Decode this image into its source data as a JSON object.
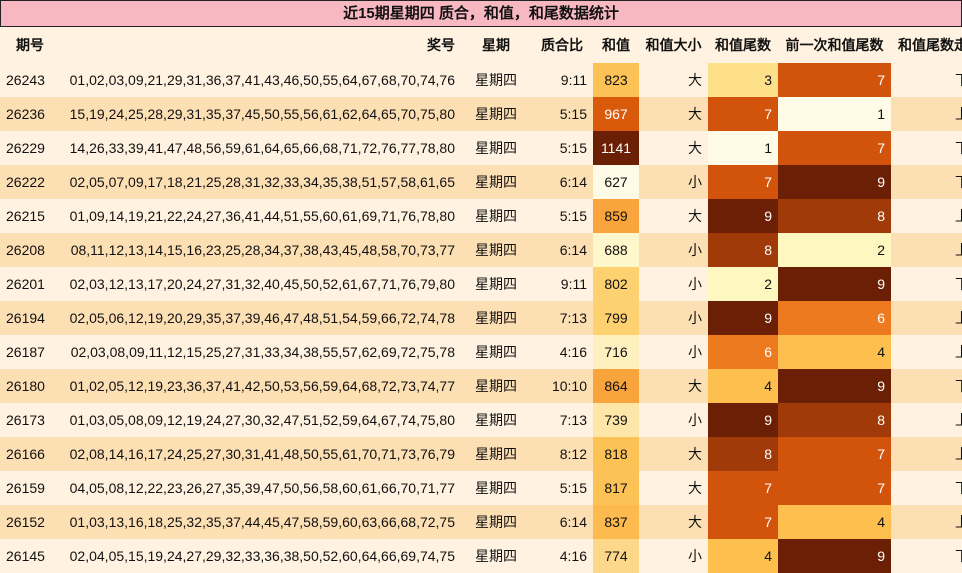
{
  "title": "近15期星期四 质合，和值，和尾数据统计",
  "headers": {
    "issue": "期号",
    "numbers": "奖号",
    "weekday": "星期",
    "ratio": "质合比",
    "sum": "和值",
    "size": "和值大小",
    "tail": "和值尾数",
    "prev_tail": "前一次和值尾数",
    "trend": "和值尾数走势"
  },
  "heat_colors": {
    "sum": {
      "627": "#fffbe6",
      "688": "#fff7cc",
      "716": "#fff0c0",
      "739": "#fde6a8",
      "774": "#fdd88a",
      "799": "#fdd070",
      "802": "#fdd070",
      "817": "#fdc256",
      "818": "#fdc256",
      "823": "#fdc256",
      "837": "#fdba4e",
      "859": "#f9a43c",
      "864": "#f9a43c",
      "967": "#d85a0a",
      "1141": "#6b2005"
    },
    "tail": {
      "1": "#fffbe6",
      "2": "#fff7c0",
      "3": "#fee08b",
      "4": "#fdc04e",
      "6": "#ee7a20",
      "7": "#d2540c",
      "8": "#a03a08",
      "9": "#6b2005"
    }
  },
  "rows": [
    {
      "issue": "26243",
      "numbers": "01,02,03,09,21,29,31,36,37,41,43,46,50,55,64,67,68,70,74,76",
      "weekday": "星期四",
      "ratio": "9:11",
      "sum": "823",
      "size": "大",
      "tail": "3",
      "prev_tail": "7",
      "trend": "下降"
    },
    {
      "issue": "26236",
      "numbers": "15,19,24,25,28,29,31,35,37,45,50,55,56,61,62,64,65,70,75,80",
      "weekday": "星期四",
      "ratio": "5:15",
      "sum": "967",
      "size": "大",
      "tail": "7",
      "prev_tail": "1",
      "trend": "上升"
    },
    {
      "issue": "26229",
      "numbers": "14,26,33,39,41,47,48,56,59,61,64,65,66,68,71,72,76,77,78,80",
      "weekday": "星期四",
      "ratio": "5:15",
      "sum": "1141",
      "size": "大",
      "tail": "1",
      "prev_tail": "7",
      "trend": "下降"
    },
    {
      "issue": "26222",
      "numbers": "02,05,07,09,17,18,21,25,28,31,32,33,34,35,38,51,57,58,61,65",
      "weekday": "星期四",
      "ratio": "6:14",
      "sum": "627",
      "size": "小",
      "tail": "7",
      "prev_tail": "9",
      "trend": "下降"
    },
    {
      "issue": "26215",
      "numbers": "01,09,14,19,21,22,24,27,36,41,44,51,55,60,61,69,71,76,78,80",
      "weekday": "星期四",
      "ratio": "5:15",
      "sum": "859",
      "size": "大",
      "tail": "9",
      "prev_tail": "8",
      "trend": "上升"
    },
    {
      "issue": "26208",
      "numbers": "08,11,12,13,14,15,16,23,25,28,34,37,38,43,45,48,58,70,73,77",
      "weekday": "星期四",
      "ratio": "6:14",
      "sum": "688",
      "size": "小",
      "tail": "8",
      "prev_tail": "2",
      "trend": "上升"
    },
    {
      "issue": "26201",
      "numbers": "02,03,12,13,17,20,24,27,31,32,40,45,50,52,61,67,71,76,79,80",
      "weekday": "星期四",
      "ratio": "9:11",
      "sum": "802",
      "size": "小",
      "tail": "2",
      "prev_tail": "9",
      "trend": "下降"
    },
    {
      "issue": "26194",
      "numbers": "02,05,06,12,19,20,29,35,37,39,46,47,48,51,54,59,66,72,74,78",
      "weekday": "星期四",
      "ratio": "7:13",
      "sum": "799",
      "size": "小",
      "tail": "9",
      "prev_tail": "6",
      "trend": "上升"
    },
    {
      "issue": "26187",
      "numbers": "02,03,08,09,11,12,15,25,27,31,33,34,38,55,57,62,69,72,75,78",
      "weekday": "星期四",
      "ratio": "4:16",
      "sum": "716",
      "size": "小",
      "tail": "6",
      "prev_tail": "4",
      "trend": "上升"
    },
    {
      "issue": "26180",
      "numbers": "01,02,05,12,19,23,36,37,41,42,50,53,56,59,64,68,72,73,74,77",
      "weekday": "星期四",
      "ratio": "10:10",
      "sum": "864",
      "size": "大",
      "tail": "4",
      "prev_tail": "9",
      "trend": "下降"
    },
    {
      "issue": "26173",
      "numbers": "01,03,05,08,09,12,19,24,27,30,32,47,51,52,59,64,67,74,75,80",
      "weekday": "星期四",
      "ratio": "7:13",
      "sum": "739",
      "size": "小",
      "tail": "9",
      "prev_tail": "8",
      "trend": "上升"
    },
    {
      "issue": "26166",
      "numbers": "02,08,14,16,17,24,25,27,30,31,41,48,50,55,61,70,71,73,76,79",
      "weekday": "星期四",
      "ratio": "8:12",
      "sum": "818",
      "size": "大",
      "tail": "8",
      "prev_tail": "7",
      "trend": "上升"
    },
    {
      "issue": "26159",
      "numbers": "04,05,08,12,22,23,26,27,35,39,47,50,56,58,60,61,66,70,71,77",
      "weekday": "星期四",
      "ratio": "5:15",
      "sum": "817",
      "size": "大",
      "tail": "7",
      "prev_tail": "7",
      "trend": "下降"
    },
    {
      "issue": "26152",
      "numbers": "01,03,13,16,18,25,32,35,37,44,45,47,58,59,60,63,66,68,72,75",
      "weekday": "星期四",
      "ratio": "6:14",
      "sum": "837",
      "size": "大",
      "tail": "7",
      "prev_tail": "4",
      "trend": "上升"
    },
    {
      "issue": "26145",
      "numbers": "02,04,05,15,19,24,27,29,32,33,36,38,50,52,60,64,66,69,74,75",
      "weekday": "星期四",
      "ratio": "4:16",
      "sum": "774",
      "size": "小",
      "tail": "4",
      "prev_tail": "9",
      "trend": "下降"
    }
  ]
}
